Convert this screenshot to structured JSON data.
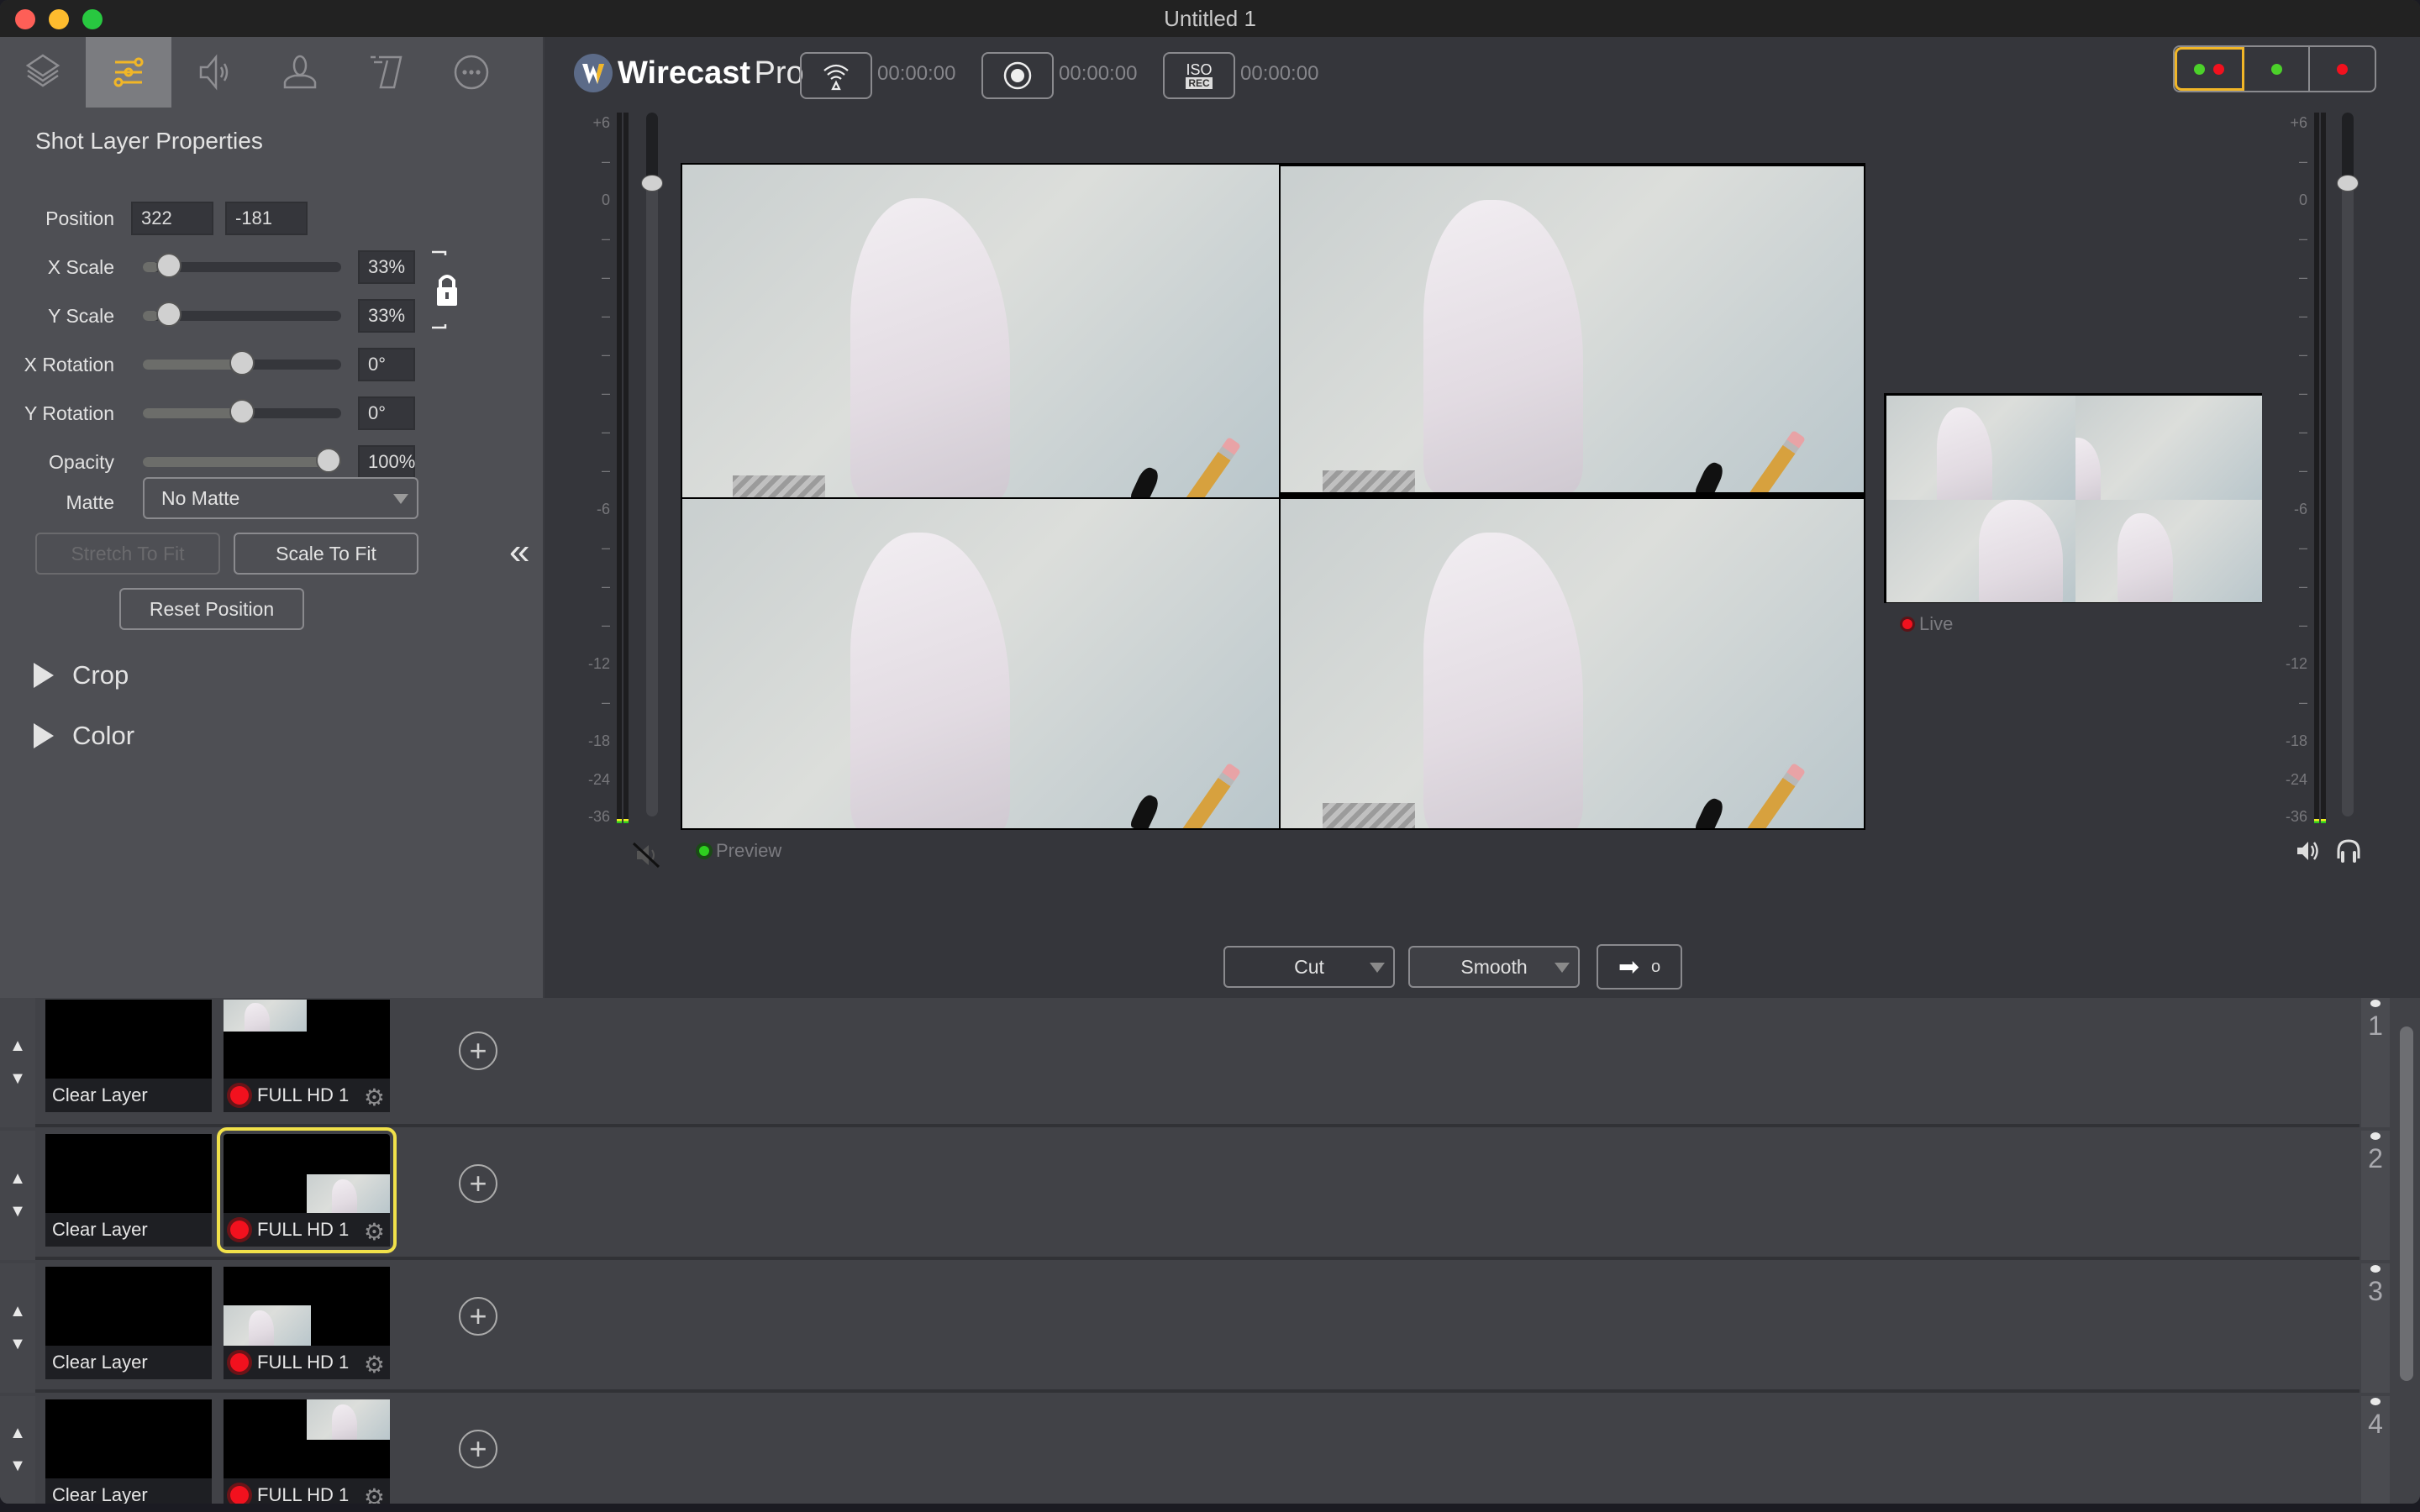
{
  "window": {
    "title": "Untitled 1"
  },
  "left_panel": {
    "tabs": [
      {
        "name": "layers",
        "icon": "layers-icon"
      },
      {
        "name": "shot-properties",
        "icon": "sliders-icon",
        "active": true
      },
      {
        "name": "audio",
        "icon": "speaker-icon"
      },
      {
        "name": "user",
        "icon": "person-icon"
      },
      {
        "name": "titles",
        "icon": "title-icon"
      },
      {
        "name": "more",
        "icon": "more-icon"
      }
    ],
    "title": "Shot Layer Properties",
    "position": {
      "label": "Position",
      "x": "322",
      "y": "-181"
    },
    "x_scale": {
      "label": "X Scale",
      "value": "33%",
      "slider_fraction": 0.08
    },
    "y_scale": {
      "label": "Y Scale",
      "value": "33%",
      "slider_fraction": 0.08
    },
    "x_rotation": {
      "label": "X Rotation",
      "value": "0°",
      "slider_fraction": 0.5
    },
    "y_rotation": {
      "label": "Y Rotation",
      "value": "0°",
      "slider_fraction": 0.5
    },
    "opacity": {
      "label": "Opacity",
      "value": "100%",
      "slider_fraction": 1.0
    },
    "scale_lock": "locked",
    "matte": {
      "label": "Matte",
      "selected": "No Matte"
    },
    "stretch_to_fit": "Stretch To Fit",
    "scale_to_fit": "Scale To Fit",
    "reset_position": "Reset Position",
    "sections": [
      "Crop",
      "Color"
    ],
    "collapse_glyph": "«"
  },
  "toolbar": {
    "app_name_bold": "Wirecast",
    "app_name_light": "Pro",
    "stream_timer": "00:00:00",
    "record_timer": "00:00:00",
    "iso_label_top": "ISO",
    "iso_label_bottom": "REC",
    "iso_timer": "00:00:00",
    "modes": [
      "preview-live",
      "preview",
      "live"
    ]
  },
  "meters": {
    "scale_labels": [
      "+6",
      "–",
      "0",
      "–",
      "–",
      "–",
      "–",
      "–",
      "–",
      "–",
      "-6",
      "–",
      "–",
      "–",
      "-12",
      "–",
      "-18",
      "-24",
      "-36"
    ],
    "left_fader_db": 0,
    "right_fader_db": 0
  },
  "preview": {
    "label": "Preview",
    "status_color": "#2ecf1f"
  },
  "live": {
    "label": "Live",
    "status_color": "#f2111e"
  },
  "transitions": {
    "first": "Cut",
    "second": "Smooth",
    "go_glyph": "➡",
    "go_indicator": "o"
  },
  "layers": [
    {
      "number": "1",
      "clear_label": "Clear Layer",
      "shot_label": "FULL HD 1",
      "selected": false
    },
    {
      "number": "2",
      "clear_label": "Clear Layer",
      "shot_label": "FULL HD 1",
      "selected": true
    },
    {
      "number": "3",
      "clear_label": "Clear Layer",
      "shot_label": "FULL HD 1",
      "selected": false
    },
    {
      "number": "4",
      "clear_label": "Clear Layer",
      "shot_label": "FULL HD 1",
      "selected": false
    }
  ],
  "colors": {
    "accent": "#f1b627",
    "selection": "#f1e14a",
    "live_red": "#f2111e",
    "preview_green": "#2ecf1f"
  }
}
